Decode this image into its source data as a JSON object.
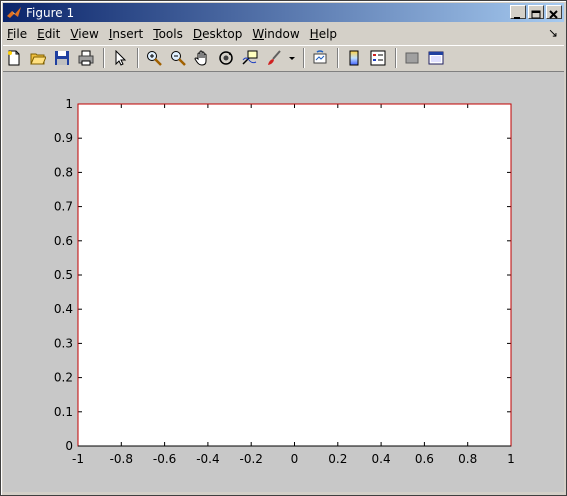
{
  "window": {
    "title": "Figure 1"
  },
  "menu": [
    {
      "label": "File",
      "key": "F"
    },
    {
      "label": "Edit",
      "key": "E"
    },
    {
      "label": "View",
      "key": "V"
    },
    {
      "label": "Insert",
      "key": "I"
    },
    {
      "label": "Tools",
      "key": "T"
    },
    {
      "label": "Desktop",
      "key": "D"
    },
    {
      "label": "Window",
      "key": "W"
    },
    {
      "label": "Help",
      "key": "H"
    }
  ],
  "toolbar_icons": [
    "new-file-icon",
    "open-folder-icon",
    "save-icon",
    "print-icon",
    "arrow-select-icon",
    "zoom-in-icon",
    "zoom-out-icon",
    "pan-hand-icon",
    "rotate-3d-icon",
    "data-cursor-icon",
    "brush-icon",
    "brush-dropdown-icon",
    "link-plot-icon",
    "colorbar-icon",
    "legend-icon",
    "hide-plot-tools-icon",
    "show-plot-tools-icon"
  ],
  "colors": {
    "axes_edge": "#c00000",
    "axes_bg": "#ffffff",
    "figure_bg": "#c8c8c8"
  },
  "chart_data": {
    "type": "line",
    "series": [],
    "xlim": [
      -1,
      1
    ],
    "ylim": [
      0,
      1
    ],
    "xticks": [
      "-1",
      "-0.8",
      "-0.6",
      "-0.4",
      "-0.2",
      "0",
      "0.2",
      "0.4",
      "0.6",
      "0.8",
      "1"
    ],
    "yticks": [
      "0",
      "0.1",
      "0.2",
      "0.3",
      "0.4",
      "0.5",
      "0.6",
      "0.7",
      "0.8",
      "0.9",
      "1"
    ],
    "grid": false
  }
}
